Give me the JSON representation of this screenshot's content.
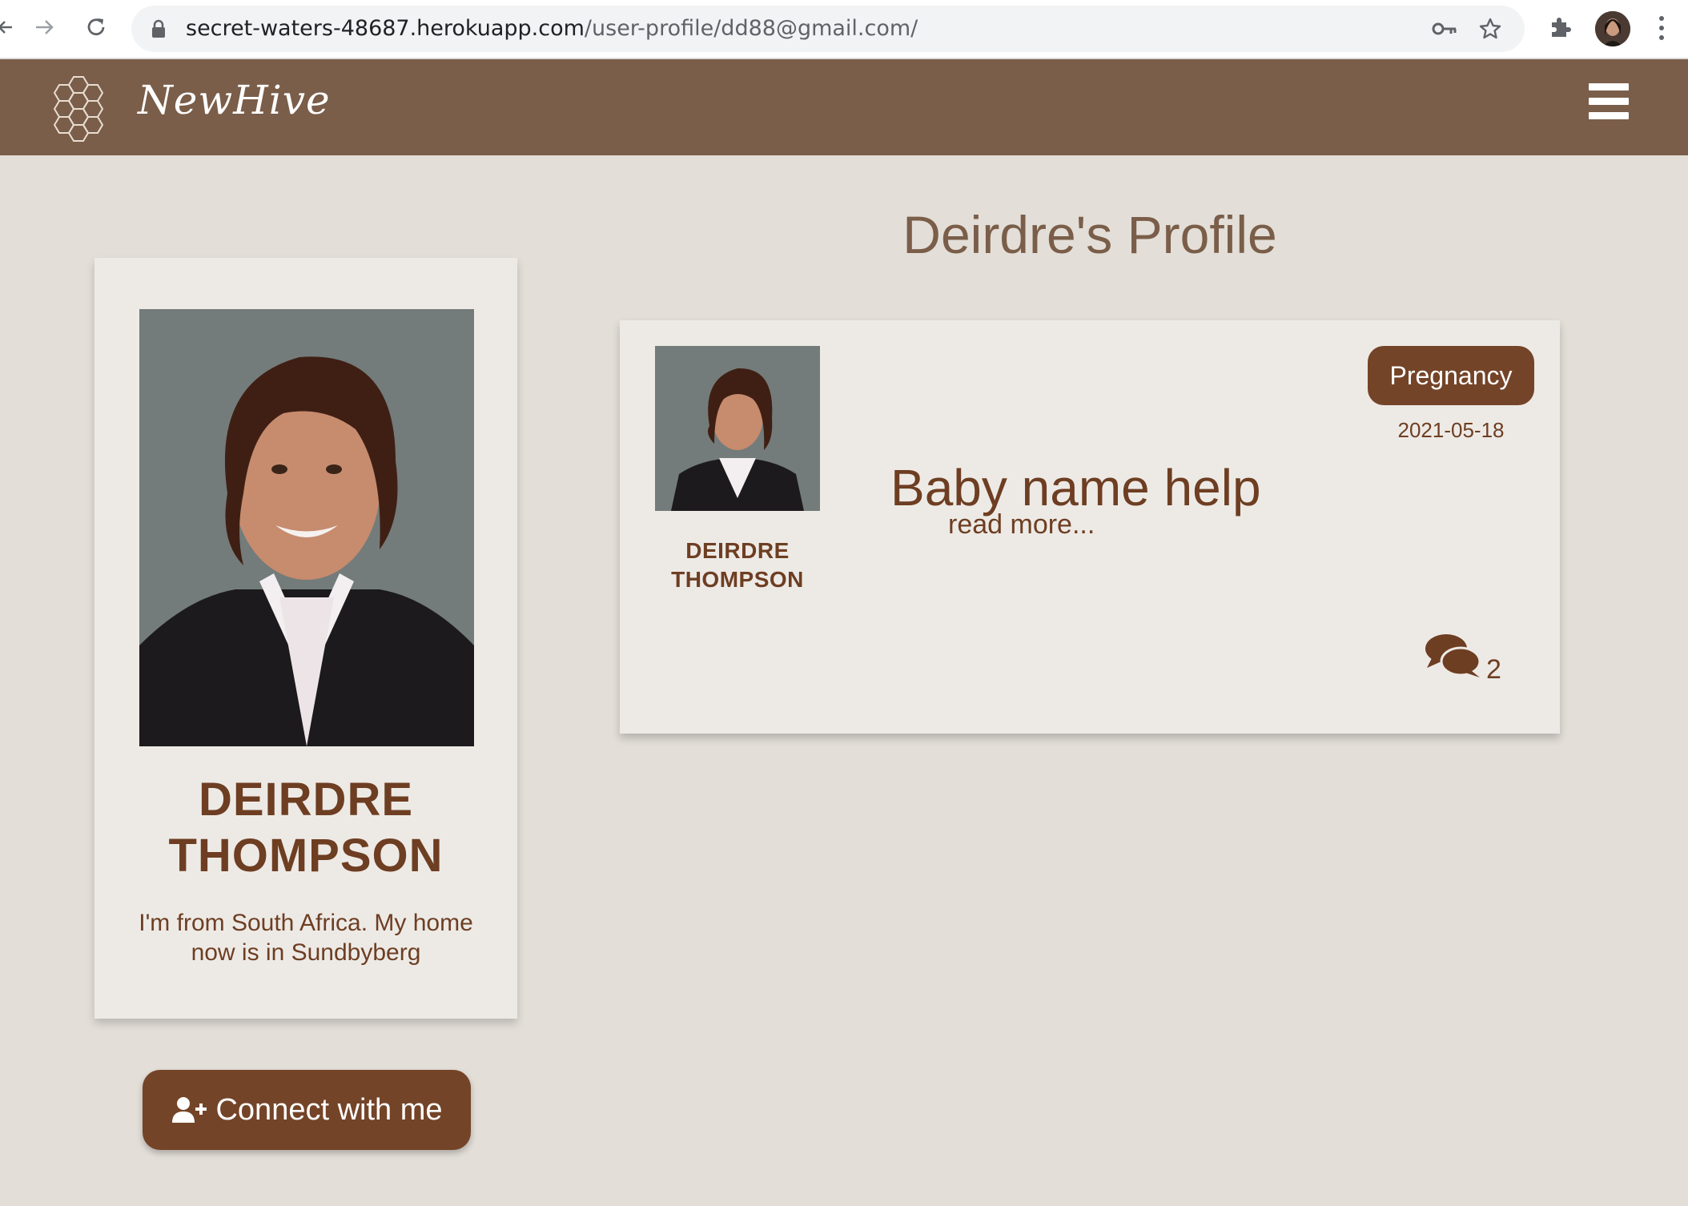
{
  "browser": {
    "url_host": "secret-waters-48687.herokuapp.com",
    "url_path": "/user-profile/dd88@gmail.com/"
  },
  "header": {
    "logo_text": "NewHive",
    "accent_color": "#7a5e49"
  },
  "page": {
    "title": "Deirdre's Profile"
  },
  "profile": {
    "name_first": "DEIRDRE",
    "name_last": "THOMPSON",
    "bio": "I'm from South Africa. My home now is in Sundbyberg",
    "connect_label": "Connect with me",
    "button_color": "#744428"
  },
  "posts": [
    {
      "author_first": "DEIRDRE",
      "author_last": "THOMPSON",
      "title": "Baby name help",
      "read_more": "read more...",
      "category": "Pregnancy",
      "date": "2021-05-18",
      "comment_count": "2"
    }
  ]
}
